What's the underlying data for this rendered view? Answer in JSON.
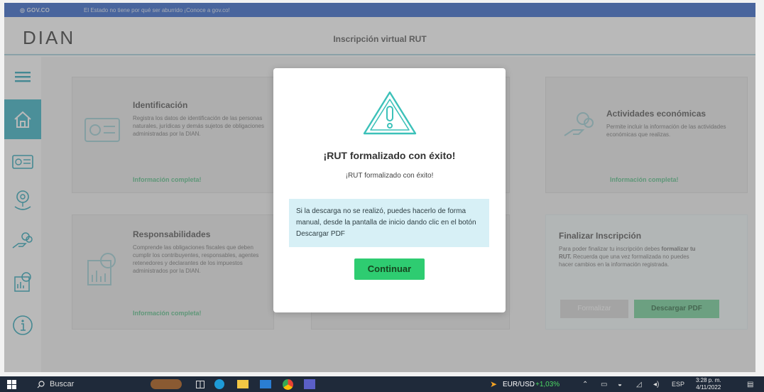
{
  "govbar": {
    "logo": "◎ GOV.CO",
    "message": "El Estado no tiene por qué ser aburrido ¡Conoce a gov.co!"
  },
  "header": {
    "brand": "DIAN",
    "title": "Inscripción virtual RUT"
  },
  "cards": {
    "identificacion": {
      "title": "Identificación",
      "text": "Registra los datos de identificación de las personas naturales, jurídicas y demás sujetos de obligaciones administradas por la DIAN.",
      "status": "Información completa!"
    },
    "actividades": {
      "title": "Actividades económicas",
      "text": "Permite incluir la información de las actividades económicas que realizas.",
      "status": "Información completa!"
    },
    "responsabilidades": {
      "title": "Responsabilidades",
      "text": "Comprende las obligaciones fiscales que deben cumplir los contribuyentes, responsables, agentes retenedores y declarantes de los impuestos administrados por la DIAN.",
      "status": "Información completa!"
    },
    "finalizar": {
      "title": "Finalizar Inscripción",
      "text_a": "Para poder finalizar tu inscripción debes ",
      "text_bold": "formalizar tu RUT.",
      "text_b": " Recuerda que una vez formalizada no puedes hacer cambios en la información registrada.",
      "formalizar": "Formalizar",
      "descargar": "Descargar PDF"
    }
  },
  "modal": {
    "title": "¡RUT formalizado con éxito!",
    "subtitle": "¡RUT formalizado con éxito!",
    "info": "Si la descarga no se realizó, puedes hacerlo de forma manual, desde la pantalla de inicio dando clic en el botón Descargar PDF",
    "button": "Continuar"
  },
  "taskbar": {
    "search": "Buscar",
    "ticker_name": "EUR/USD",
    "ticker_change": "+1,03%",
    "lang": "ESP",
    "time": "3:28 p. m.",
    "date": "4/11/2022"
  },
  "colors": {
    "accent": "#2ecc71",
    "teal": "#3cc1b9",
    "gov_blue": "#3366cc"
  }
}
